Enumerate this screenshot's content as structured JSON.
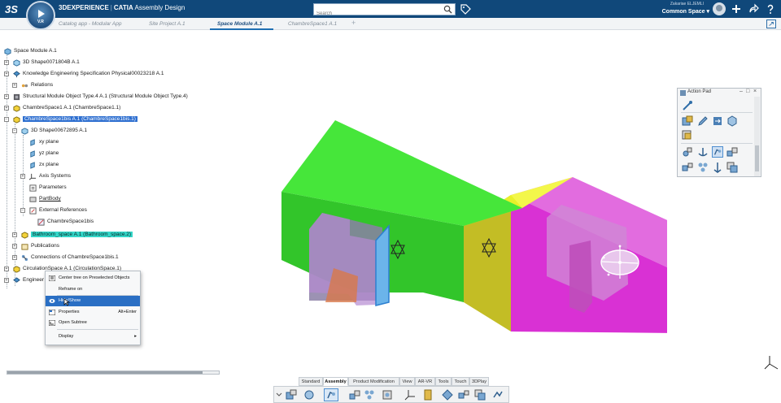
{
  "topbar": {
    "brand": "3DEXPERIENCE",
    "product": "CATIA",
    "app": "Assembly Design",
    "compass_version": "V.R",
    "search_placeholder": "Search",
    "user_name": "Zakariae ELJEMLI",
    "collab_space": "Common Space"
  },
  "tabs": [
    {
      "label": "Catalog app - Modular App"
    },
    {
      "label": "Site Project A.1"
    },
    {
      "label": "Space Module A.1"
    },
    {
      "label": "ChambreSpace1 A.1"
    }
  ],
  "tree": {
    "root": "Space Module A.1",
    "nodes": [
      "3D Shape0071804B A.1",
      "Knowledge Engineering Specification Physical00023218 A.1",
      "Relations",
      "Structural Module Object Type.4 A.1 (Structural Module Object Type.4)",
      "ChambreSpace1 A.1 (ChambreSpace1.1)",
      "ChambreSpace1bis A.1 (ChambreSpace1bis.1)",
      "3D Shape00672895 A.1",
      "xy plane",
      "yz plane",
      "zx plane",
      "Axis Systems",
      "Parameters",
      "PartBody",
      "External References",
      "ChambreSpace1bis",
      "Bathroom_space A.1 (Bathroom_space.2)",
      "Publications",
      "Connections of ChambreSpace1bis.1",
      "CirculationSpace A.1 (CirculationSpace.1)",
      "Engineer"
    ]
  },
  "context_menu": {
    "items": [
      {
        "label": "Center tree on Preselected Objects",
        "shortcut": ""
      },
      {
        "label": "Reframe on",
        "shortcut": ""
      },
      {
        "label": "Hide/Show",
        "shortcut": ""
      },
      {
        "label": "Properties",
        "shortcut": "Alt+Enter"
      },
      {
        "label": "Open Subtree",
        "shortcut": ""
      },
      {
        "label": "Display",
        "shortcut": "▸"
      }
    ]
  },
  "action_pad": {
    "title": "Action Pad"
  },
  "bottom_tabs": [
    "Standard",
    "Assembly",
    "Product Modification",
    "View",
    "AR-VR",
    "Tools",
    "Touch",
    "3DPlay"
  ],
  "colors": {
    "topbar": "#10487a",
    "green_volume": "#3fe02e",
    "yellow_volume": "#e8f02a",
    "magenta_volume": "#d931d4",
    "tree_selection": "#2e6fd0",
    "tree_highlight_teal": "#33d6c8"
  }
}
